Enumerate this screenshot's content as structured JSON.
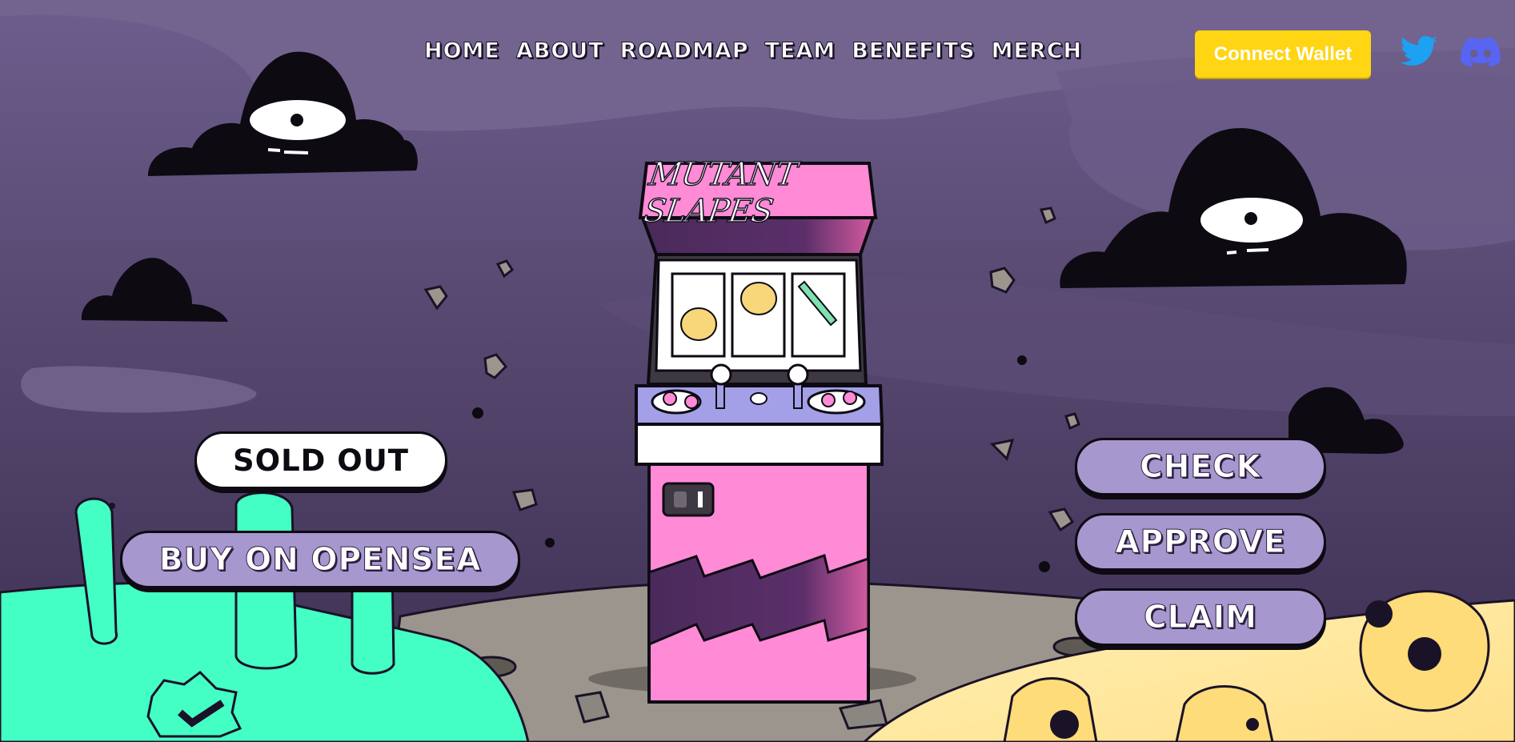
{
  "nav": {
    "links": [
      "HOME",
      "ABOUT",
      "ROADMAP",
      "TEAM",
      "BENEFITS",
      "MERCH"
    ]
  },
  "header": {
    "connect_wallet_label": "Connect Wallet",
    "social_icons": [
      "twitter-icon",
      "discord-icon"
    ]
  },
  "arcade": {
    "title": "MUTANT SLAPES"
  },
  "left_actions": {
    "sold_out_label": "SOLD OUT",
    "buy_label": "BUY ON OPENSEA"
  },
  "right_actions": {
    "check_label": "CHECK",
    "approve_label": "APPROVE",
    "claim_label": "CLAIM"
  },
  "colors": {
    "sky": "#5a4b74",
    "accent_yellow": "#ffd514",
    "button_purple": "#a797cf",
    "slime_green": "#44ffc4",
    "arcade_pink": "#ff8ad6",
    "twitter_blue": "#1da1f2",
    "discord_blue": "#5865f2"
  }
}
